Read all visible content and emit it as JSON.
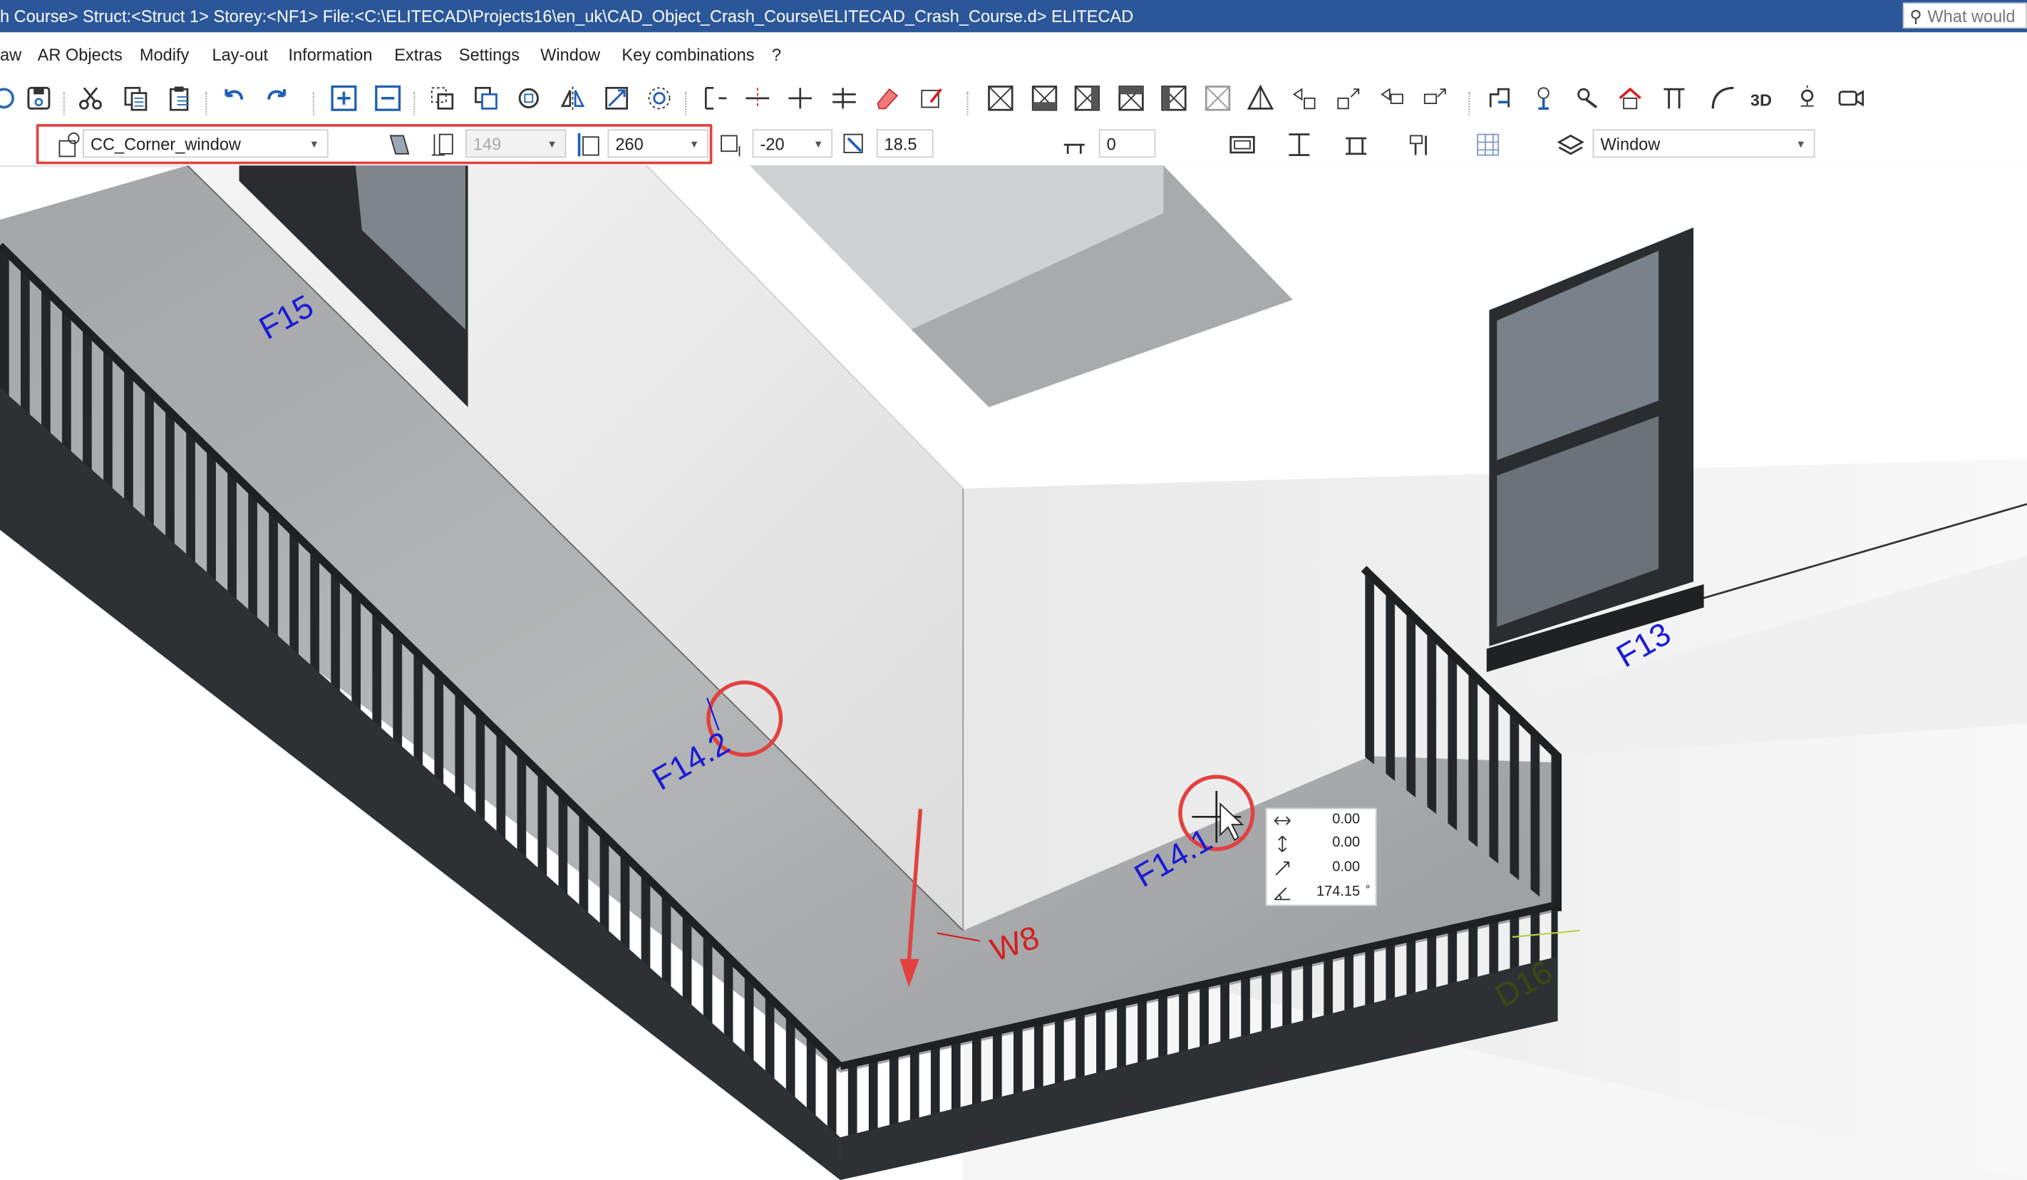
{
  "window": {
    "title": "h Course> Struct:<Struct 1>  Storey:<NF1>  File:<C:\\ELITECAD\\Projects16\\en_uk\\CAD_Object_Crash_Course\\ELITECAD_Crash_Course.d>  ELITECAD",
    "search_placeholder": "What would"
  },
  "menu": {
    "items": [
      "aw",
      "AR Objects",
      "Modify",
      "Lay-out",
      "Information",
      "Extras",
      "Settings",
      "Window",
      "Key combinations",
      "?"
    ]
  },
  "properties": {
    "object_type": "CC_Corner_window",
    "width": "149",
    "height": "260",
    "offset": "-20",
    "thickness": "18.5",
    "parapet": "0",
    "layer": "Window"
  },
  "viewport_labels": {
    "f15": "F15",
    "f14_2": "F14.2",
    "f14_1": "F14.1",
    "f13": "F13",
    "w8": "W8",
    "d16": "D16"
  },
  "coordinate_readout": {
    "dx": "0.00",
    "dy": "0.00",
    "dz": "0.00",
    "angle": "174.15",
    "angle_unit": "°"
  },
  "colors": {
    "titlebar": "#2b579a",
    "highlight": "#e2413f",
    "label_blue": "#1a1ad6",
    "label_red": "#d42020",
    "railing": "#2a2d30",
    "concrete": "#9ea0a2"
  }
}
